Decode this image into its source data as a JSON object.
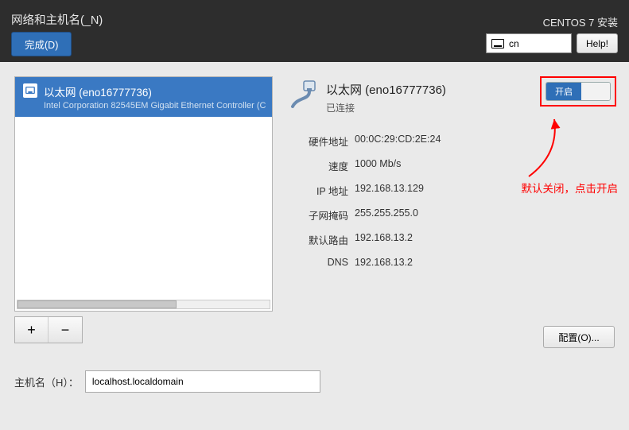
{
  "header": {
    "title": "网络和主机名(_N)",
    "done_label": "完成(D)",
    "installer_title": "CENTOS 7 安装",
    "lang": "cn",
    "help_label": "Help!"
  },
  "nic_list": {
    "items": [
      {
        "title": "以太网 (eno16777736)",
        "subtitle": "Intel Corporation 82545EM Gigabit Ethernet Controller (C"
      }
    ],
    "add_label": "+",
    "remove_label": "−"
  },
  "connection": {
    "title": "以太网 (eno16777736)",
    "status": "已连接",
    "toggle_on_label": "开启"
  },
  "details": {
    "hw_label": "硬件地址",
    "hw_value": "00:0C:29:CD:2E:24",
    "speed_label": "速度",
    "speed_value": "1000 Mb/s",
    "ip_label": "IP 地址",
    "ip_value": "192.168.13.129",
    "netmask_label": "子网掩码",
    "netmask_value": "255.255.255.0",
    "gateway_label": "默认路由",
    "gateway_value": "192.168.13.2",
    "dns_label": "DNS",
    "dns_value": "192.168.13.2"
  },
  "config_btn_label": "配置(O)...",
  "annotation_text": "默认关闭，点击开启",
  "hostname": {
    "label": "主机名（H）：",
    "value": "localhost.localdomain"
  }
}
